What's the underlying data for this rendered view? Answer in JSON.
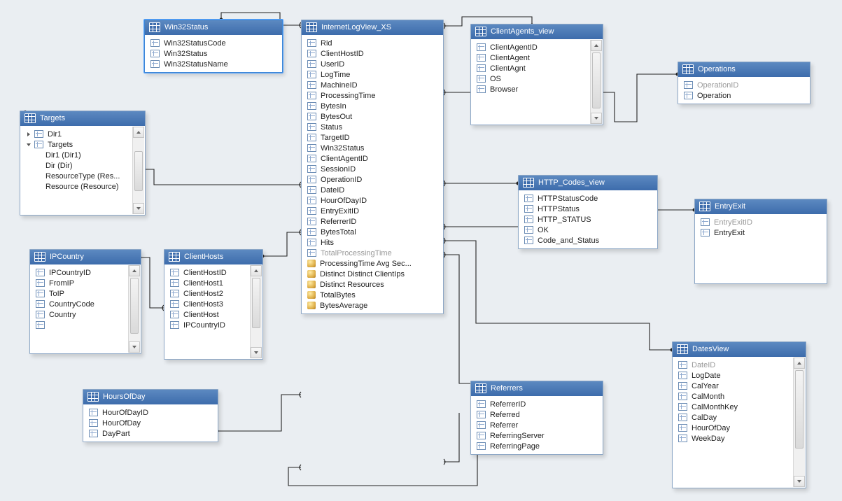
{
  "tables": {
    "win32": {
      "title": "Win32Status",
      "cols": [
        {
          "n": "Win32StatusCode"
        },
        {
          "n": "Win32Status"
        },
        {
          "n": "Win32StatusName"
        }
      ]
    },
    "targets": {
      "title": "Targets",
      "rows": [
        {
          "n": "Dir1",
          "tree": true,
          "caret": false
        },
        {
          "n": "Targets",
          "tree": true,
          "caret": true
        },
        {
          "n": "Dir1 (Dir1)",
          "indent": 2
        },
        {
          "n": "Dir (Dir)",
          "indent": 2
        },
        {
          "n": "ResourceType (Res...",
          "indent": 2
        },
        {
          "n": "Resource (Resource)",
          "indent": 2
        }
      ]
    },
    "ipcountry": {
      "title": "IPCountry",
      "cols": [
        {
          "n": "IPCountryID"
        },
        {
          "n": "FromIP"
        },
        {
          "n": "ToIP"
        },
        {
          "n": "CountryCode"
        },
        {
          "n": "Country"
        },
        {
          "n": ""
        }
      ]
    },
    "clienthosts": {
      "title": "ClientHosts",
      "cols": [
        {
          "n": "ClientHostID"
        },
        {
          "n": "ClientHost1"
        },
        {
          "n": "ClientHost2"
        },
        {
          "n": "ClientHost3"
        },
        {
          "n": "ClientHost"
        },
        {
          "n": "IPCountryID"
        }
      ]
    },
    "hoursofday": {
      "title": "HoursOfDay",
      "cols": [
        {
          "n": "HourOfDayID"
        },
        {
          "n": "HourOfDay"
        },
        {
          "n": "DayPart"
        }
      ]
    },
    "logview": {
      "title": "InternetLogView_XS",
      "cols": [
        {
          "n": "Rid"
        },
        {
          "n": "ClientHostID"
        },
        {
          "n": "UserID"
        },
        {
          "n": "LogTime"
        },
        {
          "n": "MachineID"
        },
        {
          "n": "ProcessingTime"
        },
        {
          "n": "BytesIn"
        },
        {
          "n": "BytesOut"
        },
        {
          "n": "Status"
        },
        {
          "n": "TargetID"
        },
        {
          "n": "Win32Status"
        },
        {
          "n": "ClientAgentID"
        },
        {
          "n": "SessionID"
        },
        {
          "n": "OperationID"
        },
        {
          "n": "DateID"
        },
        {
          "n": "HourOfDayID"
        },
        {
          "n": "EntryExitID"
        },
        {
          "n": "ReferrerID"
        },
        {
          "n": "BytesTotal"
        },
        {
          "n": "Hits"
        },
        {
          "n": "TotalProcessingTime",
          "dim": true
        },
        {
          "n": "ProcessingTime Avg Sec...",
          "agg": true
        },
        {
          "n": "Distinct Distinct ClientIps",
          "agg": true
        },
        {
          "n": "Distinct Resources",
          "agg": true
        },
        {
          "n": "TotalBytes",
          "agg": true
        },
        {
          "n": "BytesAverage",
          "agg": true
        }
      ]
    },
    "clientagents": {
      "title": "ClientAgents_view",
      "cols": [
        {
          "n": "ClientAgentID"
        },
        {
          "n": "ClientAgent"
        },
        {
          "n": "ClientAgnt"
        },
        {
          "n": "OS"
        },
        {
          "n": "Browser"
        }
      ]
    },
    "operations": {
      "title": "Operations",
      "cols": [
        {
          "n": "OperationID",
          "dim": true
        },
        {
          "n": "Operation"
        }
      ]
    },
    "httpcodes": {
      "title": "HTTP_Codes_view",
      "cols": [
        {
          "n": "HTTPStatusCode"
        },
        {
          "n": "HTTPStatus"
        },
        {
          "n": "HTTP_STATUS"
        },
        {
          "n": "OK"
        },
        {
          "n": "Code_and_Status"
        }
      ]
    },
    "entryexit": {
      "title": "EntryExit",
      "cols": [
        {
          "n": "EntryExitID",
          "dim": true
        },
        {
          "n": "EntryExit"
        }
      ]
    },
    "referrers": {
      "title": "Referrers",
      "cols": [
        {
          "n": "ReferrerID"
        },
        {
          "n": "Referred"
        },
        {
          "n": "Referrer"
        },
        {
          "n": "ReferringServer"
        },
        {
          "n": "ReferringPage"
        }
      ]
    },
    "datesview": {
      "title": "DatesView",
      "cols": [
        {
          "n": "DateID",
          "dim": true
        },
        {
          "n": "LogDate"
        },
        {
          "n": "CalYear"
        },
        {
          "n": "CalMonth"
        },
        {
          "n": "CalMonthKey"
        },
        {
          "n": "CalDay"
        },
        {
          "n": "HourOfDay"
        },
        {
          "n": "WeekDay"
        }
      ]
    }
  }
}
